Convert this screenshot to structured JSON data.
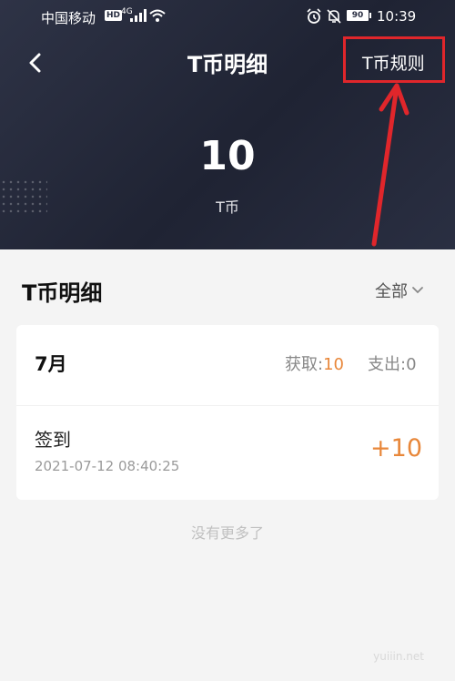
{
  "status_bar": {
    "carrier": "中国移动",
    "hd_badge": "HD",
    "network": "4G",
    "battery": "90",
    "time": "10:39"
  },
  "header": {
    "title": "T币明细",
    "rules_label": "T币规则",
    "balance": "10",
    "unit": "T币"
  },
  "section": {
    "title": "T币明细",
    "filter_label": "全部"
  },
  "month_summary": {
    "month": "7月",
    "gain_label": "获取:",
    "gain_value": "10",
    "spend_label": "支出:",
    "spend_value": "0"
  },
  "records": [
    {
      "title": "签到",
      "time": "2021-07-12 08:40:25",
      "amount": "+10"
    }
  ],
  "footer": {
    "no_more": "没有更多了",
    "watermark": "yuiiin.net"
  },
  "colors": {
    "header_bg": "#2a2f42",
    "accent_orange": "#e8873a",
    "annotation_red": "#e0262b"
  }
}
